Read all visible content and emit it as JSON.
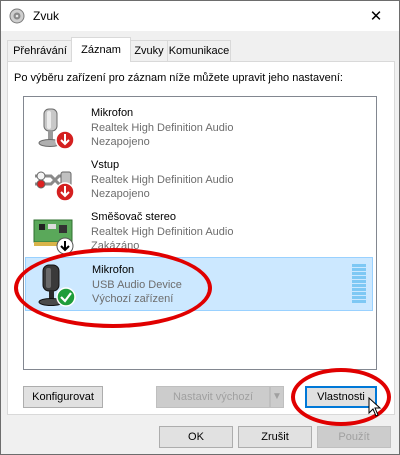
{
  "window": {
    "title": "Zvuk",
    "close_glyph": "✕"
  },
  "tabs": [
    {
      "label": "Přehrávání"
    },
    {
      "label": "Záznam"
    },
    {
      "label": "Zvuky"
    },
    {
      "label": "Komunikace"
    }
  ],
  "instruction": "Po výběru zařízení pro záznam níže můžete upravit jeho nastavení:",
  "devices": [
    {
      "name": "Mikrofon",
      "line1": "Realtek High Definition Audio",
      "line2": "Nezapojeno",
      "icon": "microphone-icon",
      "badge": "red-down-arrow"
    },
    {
      "name": "Vstup",
      "line1": "Realtek High Definition Audio",
      "line2": "Nezapojeno",
      "icon": "line-in-cable-icon",
      "badge": "red-down-arrow"
    },
    {
      "name": "Směšovač stereo",
      "line1": "Realtek High Definition Audio",
      "line2": "Zakázáno",
      "icon": "sound-card-icon",
      "badge": "black-down-arrow"
    },
    {
      "name": "Mikrofon",
      "line1": "USB Audio Device",
      "line2": "Výchozí zařízení",
      "icon": "usb-microphone-icon",
      "badge": "green-check"
    }
  ],
  "buttons": {
    "configure": "Konfigurovat",
    "set_default": "Nastavit výchozí",
    "set_default_arrow": "▼",
    "properties": "Vlastnosti",
    "ok": "OK",
    "cancel": "Zrušit",
    "apply": "Použít"
  },
  "colors": {
    "selection": "#cce8ff",
    "annotation": "#e00000",
    "focus": "#0078d7"
  }
}
